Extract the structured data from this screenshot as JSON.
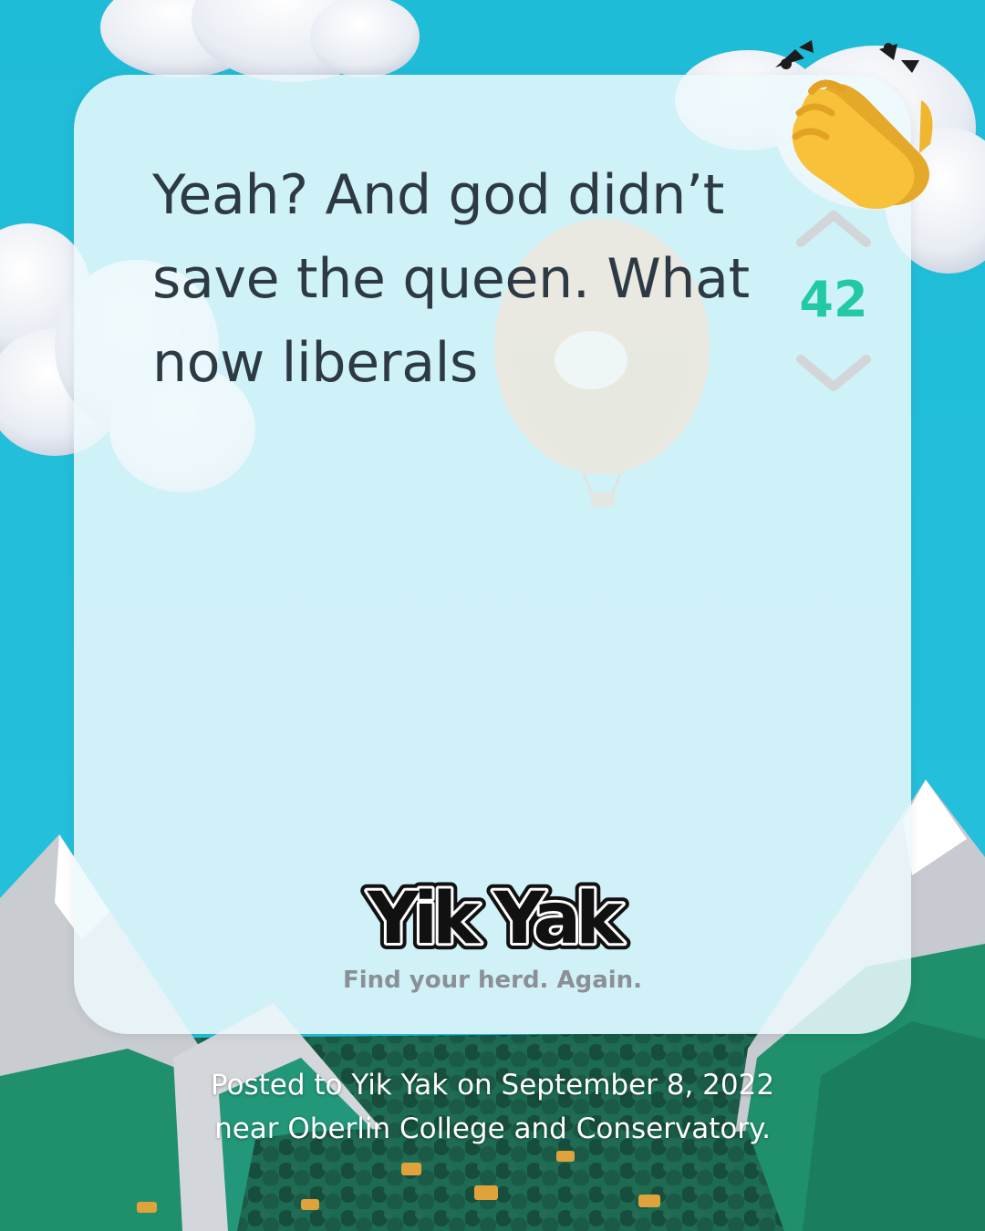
{
  "post": {
    "text": "Yeah? And god didn’t save the queen. What now liberals",
    "vote_count": "42"
  },
  "brand": {
    "logo_text": "Yik Yak",
    "tagline": "Find your herd. Again."
  },
  "caption": "Posted to Yik Yak on September 8, 2022 near Oberlin College and Conservatory.",
  "icons": {
    "upvote": "chevron-up-icon",
    "downvote": "chevron-down-icon",
    "reaction": "clapping-hands-icon"
  },
  "colors": {
    "sky": "#1fbcd8",
    "card": "#ecf9fd",
    "text": "#2d3a44",
    "vote_count": "#23c9a5",
    "vote_arrow": "#d3d6d8",
    "tagline": "#8a9095",
    "mountain_green": "#1f8f6c",
    "forest": "#1b5a45"
  }
}
